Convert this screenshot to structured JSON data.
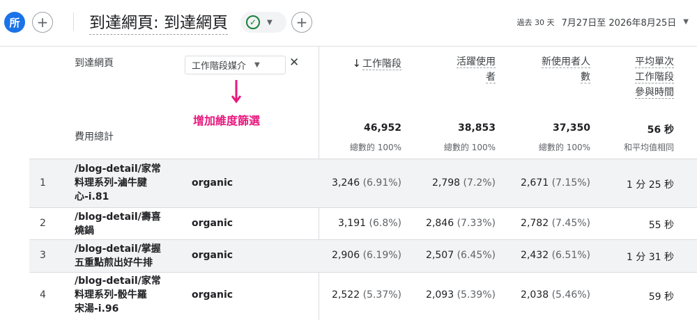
{
  "header": {
    "avatar_label": "所",
    "add_comparison_label": "+",
    "title": "到達網頁: 到達網頁",
    "status_check": "✓",
    "add_button_label": "+",
    "date_period": "過去 30 天",
    "date_range": "7月27日至 2026年8月25日"
  },
  "table": {
    "dimension_label": "到達網頁",
    "secondary_dimension": "工作階段媒介",
    "annotation": "增加維度篩選",
    "totals_label": "費用總計",
    "columns": [
      {
        "label_line1": "工作階段",
        "label_line2": "",
        "label_line3": "",
        "sorted": true,
        "total": "46,952",
        "total_sub": "總數的 100%"
      },
      {
        "label_line1": "活躍使用",
        "label_line2": "者",
        "label_line3": "",
        "sorted": false,
        "total": "38,853",
        "total_sub": "總數的 100%"
      },
      {
        "label_line1": "新使用者人",
        "label_line2": "數",
        "label_line3": "",
        "sorted": false,
        "total": "37,350",
        "total_sub": "總數的 100%"
      },
      {
        "label_line1": "平均單次",
        "label_line2": "工作階段",
        "label_line3": "參與時間",
        "sorted": false,
        "total": "56 秒",
        "total_sub": "和平均值相同"
      }
    ],
    "rows": [
      {
        "index": "1",
        "page_l1": "/blog-detail/家常",
        "page_l2": "料理系列-滷牛腱",
        "page_l3": "心-i.81",
        "medium": "organic",
        "sessions": "3,246",
        "sessions_pct": "(6.91%)",
        "active": "2,798",
        "active_pct": "(7.2%)",
        "new": "2,671",
        "new_pct": "(7.15%)",
        "engagement": "1 分 25 秒"
      },
      {
        "index": "2",
        "page_l1": "/blog-detail/壽喜",
        "page_l2": "燒鍋",
        "page_l3": "",
        "medium": "organic",
        "sessions": "3,191",
        "sessions_pct": "(6.8%)",
        "active": "2,846",
        "active_pct": "(7.33%)",
        "new": "2,782",
        "new_pct": "(7.45%)",
        "engagement": "55 秒"
      },
      {
        "index": "3",
        "page_l1": "/blog-detail/掌握",
        "page_l2": "五重點煎出好牛排",
        "page_l3": "",
        "medium": "organic",
        "sessions": "2,906",
        "sessions_pct": "(6.19%)",
        "active": "2,507",
        "active_pct": "(6.45%)",
        "new": "2,432",
        "new_pct": "(6.51%)",
        "engagement": "1 分 31 秒"
      },
      {
        "index": "4",
        "page_l1": "/blog-detail/家常",
        "page_l2": "料理系列-骰牛羅",
        "page_l3": "宋湯-i.96",
        "medium": "organic",
        "sessions": "2,522",
        "sessions_pct": "(5.37%)",
        "active": "2,093",
        "active_pct": "(5.39%)",
        "new": "2,038",
        "new_pct": "(5.46%)",
        "engagement": "59 秒"
      }
    ]
  },
  "colors": {
    "accent": "#1a73e8",
    "annotation": "#e8177d",
    "row_shade": "#f1f3f4",
    "ok": "#188038"
  }
}
